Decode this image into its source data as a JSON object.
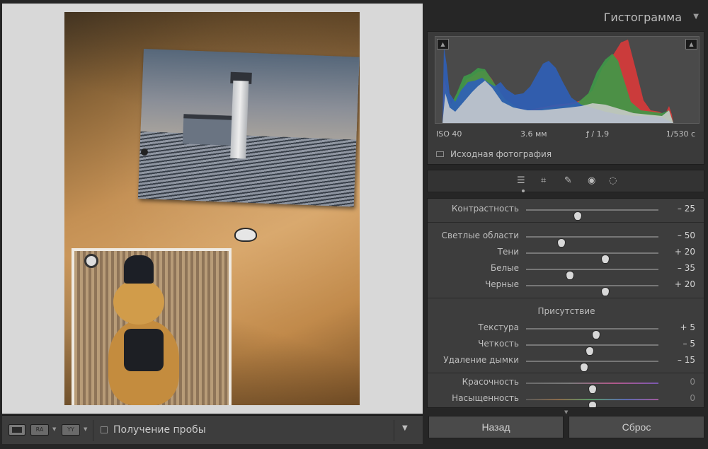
{
  "toolbar": {
    "view_modes": [
      "",
      "RA",
      "YY"
    ],
    "soft_proof_label": "Получение пробы"
  },
  "histogram": {
    "title": "Гистограмма",
    "meta": {
      "iso": "ISO 40",
      "focal": "3.6 мм",
      "aperture": "ƒ / 1,9",
      "shutter": "1/530 с"
    },
    "original_photo_label": "Исходная фотография"
  },
  "tools": [
    "sliders-icon",
    "crop-icon",
    "healing-icon",
    "redeye-icon",
    "mask-icon"
  ],
  "adjustments": {
    "contrast": {
      "label": "Контрастность",
      "value": "– 25",
      "pos": 0.39
    },
    "highlights": {
      "label": "Светлые области",
      "value": "– 50",
      "pos": 0.27
    },
    "shadows": {
      "label": "Тени",
      "value": "+ 20",
      "pos": 0.6
    },
    "whites": {
      "label": "Белые",
      "value": "– 35",
      "pos": 0.33
    },
    "blacks": {
      "label": "Черные",
      "value": "+ 20",
      "pos": 0.6
    },
    "presence_title": "Присутствие",
    "texture": {
      "label": "Текстура",
      "value": "+ 5",
      "pos": 0.53
    },
    "clarity": {
      "label": "Четкость",
      "value": "– 5",
      "pos": 0.48
    },
    "dehaze": {
      "label": "Удаление дымки",
      "value": "– 15",
      "pos": 0.44
    },
    "vibrance": {
      "label": "Красочность",
      "value": "0",
      "pos": 0.5
    },
    "saturation": {
      "label": "Насыщенность",
      "value": "0",
      "pos": 0.5
    }
  },
  "buttons": {
    "back": "Назад",
    "reset": "Сброс"
  },
  "colors": {
    "red": "#d23a3a",
    "green": "#3e9a48",
    "blue": "#2f5fb8",
    "grey": "#cfcfcf"
  }
}
